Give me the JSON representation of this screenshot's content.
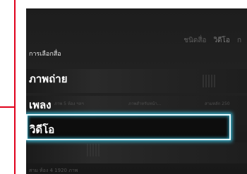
{
  "background": {
    "tabs": [
      "ชนิดสื่อ",
      "วิดีโอ",
      "ก"
    ],
    "active_tab": "วิดีโอ",
    "captions": [
      "ภาพ 5 ห้อง ฯลฯ",
      "ภาพสำหรับหน้า...",
      "สามหลัก 250"
    ],
    "footer": "สาม ห้อง 4 1920 ภาพ"
  },
  "menu": {
    "title": "การเลือกสื่อ",
    "items": [
      "ภาพถ่าย",
      "เพลง",
      "วิดีโอ"
    ],
    "selected": "วิดีโอ"
  },
  "colors": {
    "frame": "#e0001b",
    "highlight": "#38b7d3"
  }
}
